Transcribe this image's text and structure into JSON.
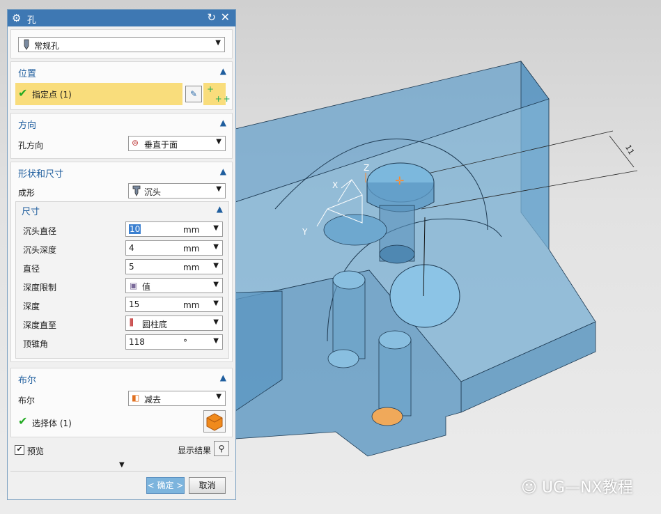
{
  "dialog": {
    "title": "孔",
    "type_select": "常规孔",
    "sections": {
      "position": {
        "title": "位置",
        "point_label": "指定点 (1)"
      },
      "direction": {
        "title": "方向",
        "hole_dir_label": "孔方向",
        "hole_dir_value": "垂直于面"
      },
      "form": {
        "title": "形状和尺寸",
        "form_label": "成形",
        "form_value": "沉头"
      },
      "dimensions": {
        "title": "尺寸",
        "rows": [
          {
            "label": "沉头直径",
            "value": "10",
            "unit": "mm"
          },
          {
            "label": "沉头深度",
            "value": "4",
            "unit": "mm"
          },
          {
            "label": "直径",
            "value": "5",
            "unit": "mm"
          },
          {
            "label": "深度限制",
            "value": "值",
            "unit": ""
          },
          {
            "label": "深度",
            "value": "15",
            "unit": "mm"
          },
          {
            "label": "深度直至",
            "value": "圆柱底",
            "unit": ""
          },
          {
            "label": "顶锥角",
            "value": "118",
            "unit": "°"
          }
        ]
      },
      "boolean": {
        "title": "布尔",
        "bool_label": "布尔",
        "bool_value": "减去",
        "body_label": "选择体 (1)"
      }
    },
    "preview_label": "预览",
    "show_result_label": "显示结果",
    "ok_label": "< 确定 >",
    "cancel_label": "取消"
  },
  "viewport": {
    "axis_x": "X",
    "axis_y": "Y",
    "axis_z": "Z",
    "dimension": "11",
    "watermark": "UG—NX教程"
  },
  "colors": {
    "accent": "#3e78b3",
    "highlight": "#f9dd7c",
    "model": "#6fa9d0",
    "check": "#22aa22"
  }
}
